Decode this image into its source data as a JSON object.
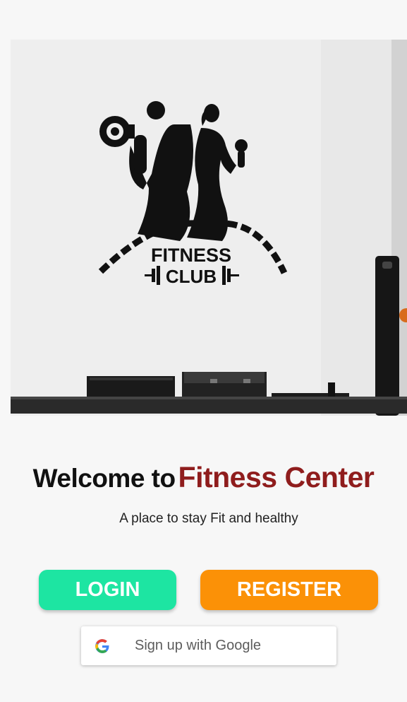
{
  "hero": {
    "logo_line1": "FITNESS",
    "logo_line2": "CLUB"
  },
  "welcome": {
    "prefix": "Welcome to",
    "highlight": "Fitness Center"
  },
  "tagline": "A place to stay Fit and healthy",
  "buttons": {
    "login": "LOGIN",
    "register": "REGISTER",
    "google": "Sign up with Google"
  },
  "colors": {
    "login_bg": "#1de5a2",
    "register_bg": "#fb9107",
    "highlight_text": "#8f1d1d"
  },
  "icons": {
    "google": "google-g-icon",
    "logo": "fitness-club-logo"
  }
}
